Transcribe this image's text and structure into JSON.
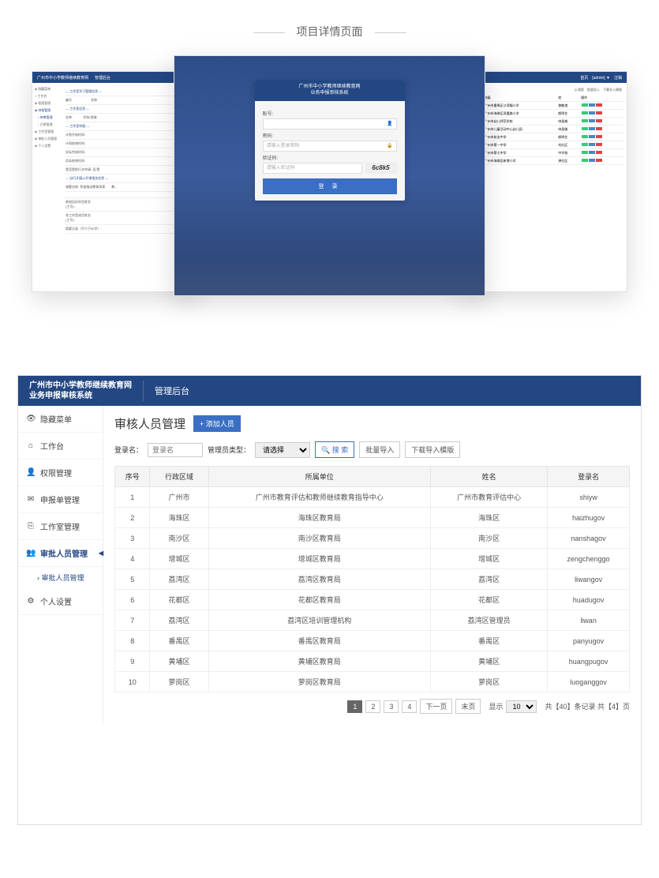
{
  "top_title": "项目详情页面",
  "login": {
    "title1": "广州市中小学教师继续教育网",
    "title2": "业务申报审核系统",
    "acc_label": "账号:",
    "acc_placeholder": "",
    "pwd_label": "密码:",
    "pwd_placeholder": "请输入登录密码",
    "cap_label": "验证码:",
    "cap_placeholder": "请输入验证码",
    "cap_value": "6c8k5",
    "btn": "登 录"
  },
  "admin": {
    "logo1": "广州市中小学教师继续教育网",
    "logo2": "业务申报审核系统",
    "nav": "管理后台",
    "sidebar": [
      {
        "icon": "👁",
        "label": "隐藏菜单"
      },
      {
        "icon": "⌂",
        "label": "工作台"
      },
      {
        "icon": "👤",
        "label": "权限管理"
      },
      {
        "icon": "✉",
        "label": "申报单管理"
      },
      {
        "icon": "⎘",
        "label": "工作室管理"
      },
      {
        "icon": "👥",
        "label": "审批人员管理",
        "active": true
      },
      {
        "icon": "",
        "label": "审批人员管理",
        "sub": true
      },
      {
        "icon": "⚙",
        "label": "个人设置"
      }
    ],
    "page_title": "审核人员管理",
    "add_btn": "添加人员",
    "search": {
      "login_label": "登录名：",
      "login_placeholder": "登录名",
      "type_label": "管理员类型：",
      "type_placeholder": "请选择",
      "search_btn": "搜 索",
      "import_btn": "批量导入",
      "template_btn": "下载导入模版"
    },
    "columns": [
      "序号",
      "行政区域",
      "所属单位",
      "姓名",
      "登录名"
    ],
    "rows": [
      [
        "1",
        "广州市",
        "广州市教育评估和教师继续教育指导中心",
        "广州市教育评估中心",
        "shiyw"
      ],
      [
        "2",
        "海珠区",
        "海珠区教育局",
        "海珠区",
        "haizhugov"
      ],
      [
        "3",
        "南沙区",
        "南沙区教育局",
        "南沙区",
        "nanshagov"
      ],
      [
        "4",
        "增城区",
        "增城区教育局",
        "增城区",
        "zengchenggo"
      ],
      [
        "5",
        "荔湾区",
        "荔湾区教育局",
        "荔湾区",
        "liwangov"
      ],
      [
        "6",
        "花都区",
        "花都区教育局",
        "花都区",
        "huadugov"
      ],
      [
        "7",
        "荔湾区",
        "荔湾区培训管理机构",
        "荔湾区管理员",
        "liwan"
      ],
      [
        "8",
        "番禺区",
        "番禺区教育局",
        "番禺区",
        "panyugov"
      ],
      [
        "9",
        "黄埔区",
        "黄埔区教育局",
        "黄埔区",
        "huangpugov"
      ],
      [
        "10",
        "萝岗区",
        "萝岗区教育局",
        "萝岗区",
        "luoganggov"
      ]
    ],
    "pager": {
      "pages": [
        "1",
        "2",
        "3",
        "4"
      ],
      "next": "下一页",
      "last": "末页",
      "show": "显示",
      "per": "10",
      "total_text": "共【40】条记录 共【4】页"
    }
  }
}
